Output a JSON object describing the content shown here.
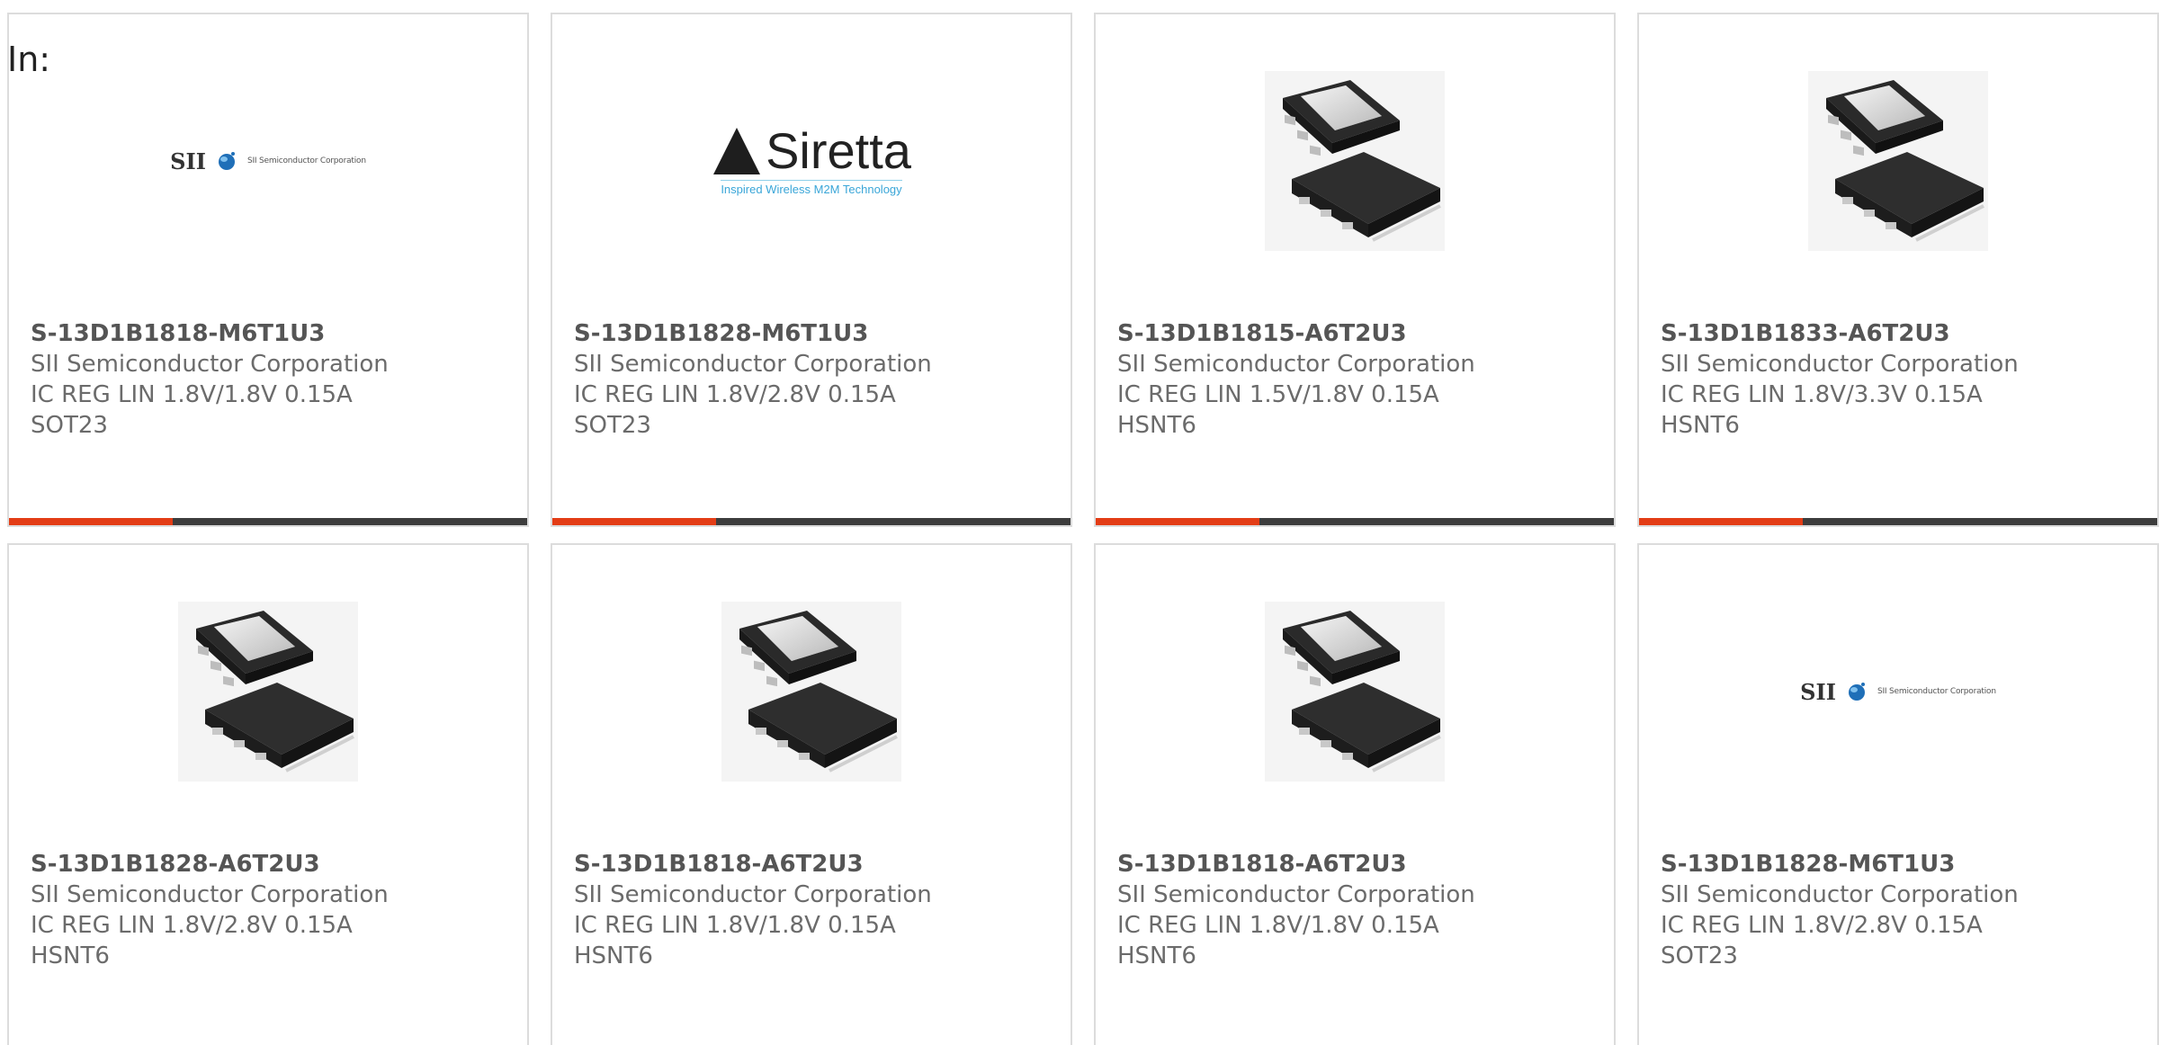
{
  "header": {
    "in_label": "In:"
  },
  "colors": {
    "accent": "#e33d16",
    "bar": "#3d3d3d"
  },
  "logos": {
    "sii": {
      "mark": "SII",
      "sub": "SII Semiconductor Corporation"
    },
    "siretta": {
      "word": "Siretta",
      "tagline": "Inspired Wireless M2M Technology"
    }
  },
  "products": [
    {
      "part": "S-13D1B1818-M6T1U3",
      "mfr": "SII Semiconductor Corporation",
      "desc": "IC REG LIN 1.8V/1.8V 0.15A",
      "pkg": "SOT23",
      "image": "sii-logo"
    },
    {
      "part": "S-13D1B1828-M6T1U3",
      "mfr": "SII Semiconductor Corporation",
      "desc": "IC REG LIN 1.8V/2.8V 0.15A",
      "pkg": "SOT23",
      "image": "siretta-logo"
    },
    {
      "part": "S-13D1B1815-A6T2U3",
      "mfr": "SII Semiconductor Corporation",
      "desc": "IC REG LIN 1.5V/1.8V 0.15A",
      "pkg": "HSNT6",
      "image": "chip-package"
    },
    {
      "part": "S-13D1B1833-A6T2U3",
      "mfr": "SII Semiconductor Corporation",
      "desc": "IC REG LIN 1.8V/3.3V 0.15A",
      "pkg": "HSNT6",
      "image": "chip-package"
    },
    {
      "part": "S-13D1B1828-A6T2U3",
      "mfr": "SII Semiconductor Corporation",
      "desc": "IC REG LIN 1.8V/2.8V 0.15A",
      "pkg": "HSNT6",
      "image": "chip-package"
    },
    {
      "part": "S-13D1B1818-A6T2U3",
      "mfr": "SII Semiconductor Corporation",
      "desc": "IC REG LIN 1.8V/1.8V 0.15A",
      "pkg": "HSNT6",
      "image": "chip-package"
    },
    {
      "part": "S-13D1B1818-A6T2U3",
      "mfr": "SII Semiconductor Corporation",
      "desc": "IC REG LIN 1.8V/1.8V 0.15A",
      "pkg": "HSNT6",
      "image": "chip-package"
    },
    {
      "part": "S-13D1B1828-M6T1U3",
      "mfr": "SII Semiconductor Corporation",
      "desc": "IC REG LIN 1.8V/2.8V 0.15A",
      "pkg": "SOT23",
      "image": "sii-logo"
    }
  ]
}
